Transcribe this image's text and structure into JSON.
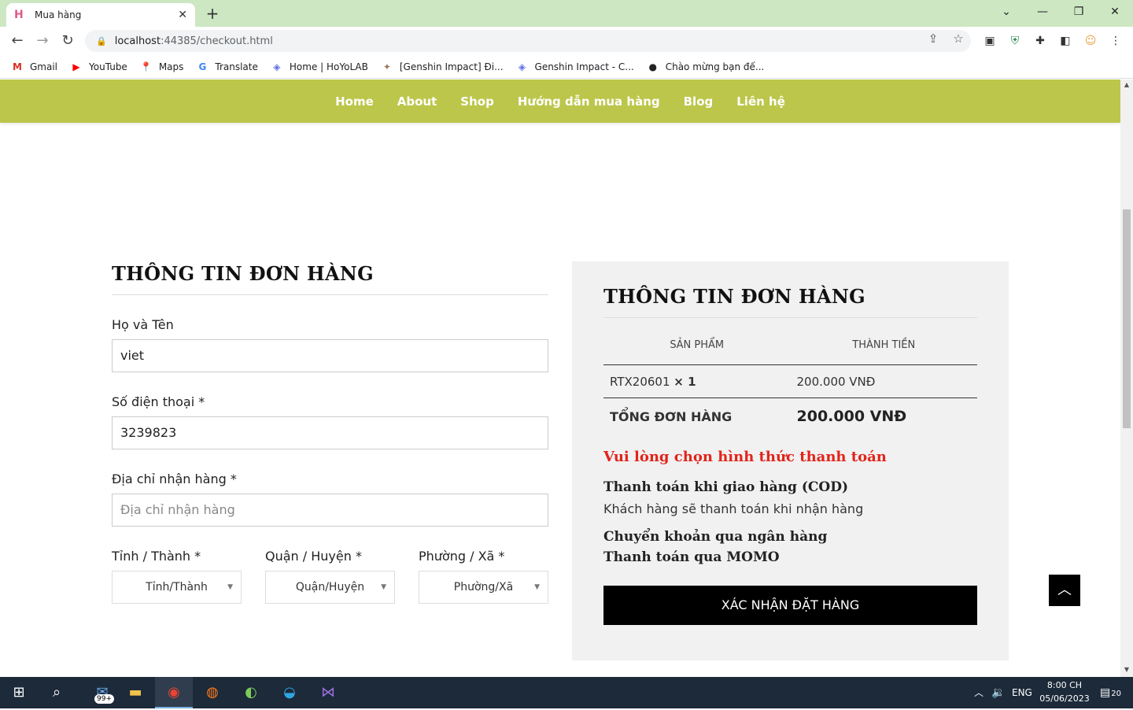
{
  "browser": {
    "tab_title": "Mua hàng",
    "tab_favicon": "H",
    "url_host": "localhost",
    "url_rest": ":44385/checkout.html",
    "bookmarks": [
      {
        "label": "Gmail",
        "icon": "gmail-icon",
        "glyph": "M",
        "color": "#d93025"
      },
      {
        "label": "YouTube",
        "icon": "youtube-icon",
        "glyph": "▶",
        "color": "#ff0000"
      },
      {
        "label": "Maps",
        "icon": "maps-icon",
        "glyph": "📍",
        "color": "#34a853"
      },
      {
        "label": "Translate",
        "icon": "translate-icon",
        "glyph": "G",
        "color": "#4285f4"
      },
      {
        "label": "Home | HoYoLAB",
        "icon": "hoyolab-icon",
        "glyph": "◈",
        "color": "#5b6ee1"
      },
      {
        "label": "[Genshin Impact] Đi...",
        "icon": "genshin-icon",
        "glyph": "✦",
        "color": "#a0785a"
      },
      {
        "label": "Genshin Impact - C...",
        "icon": "hoyolab-icon",
        "glyph": "◈",
        "color": "#5b6ee1"
      },
      {
        "label": "Chào mừng bạn đế...",
        "icon": "globe-icon",
        "glyph": "●",
        "color": "#222222"
      }
    ]
  },
  "nav": {
    "items": [
      "Home",
      "About",
      "Shop",
      "Hướng dẫn mua hàng",
      "Blog",
      "Liên hệ"
    ]
  },
  "form": {
    "title": "THÔNG TIN ĐƠN HÀNG",
    "name_label": "Họ và Tên",
    "name_value": "viet",
    "phone_label": "Số điện thoại *",
    "phone_value": "3239823",
    "address_label": "Địa chỉ nhận hàng *",
    "address_placeholder": "Địa chỉ nhận hàng",
    "province_label": "Tỉnh / Thành *",
    "province_value": "Tỉnh/Thành",
    "district_label": "Quận / Huyện *",
    "district_value": "Quận/Huyện",
    "ward_label": "Phường / Xã *",
    "ward_value": "Phường/Xã"
  },
  "summary": {
    "title": "THÔNG TIN ĐƠN HÀNG",
    "col_product": "SẢN PHẨM",
    "col_total": "THÀNH TIỀN",
    "item_name": "RTX20601",
    "item_qty": "× 1",
    "item_price": "200.000 VNĐ",
    "total_label": "TỔNG ĐƠN HÀNG",
    "total_value": "200.000 VNĐ",
    "pay_warning": "Vui lòng chọn hình thức thanh toán",
    "pay_cod": "Thanh toán khi giao hàng (COD)",
    "pay_cod_desc": "Khách hàng sẽ thanh toán khi nhận hàng",
    "pay_bank": "Chuyển khoản qua ngân hàng",
    "pay_momo": "Thanh toán qua MOMO",
    "confirm_label": "XÁC NHẬN ĐẶT HÀNG"
  },
  "taskbar": {
    "mail_badge": "99+",
    "lang": "ENG",
    "time": "8:00 CH",
    "date": "05/06/2023",
    "notif_count": "20"
  }
}
